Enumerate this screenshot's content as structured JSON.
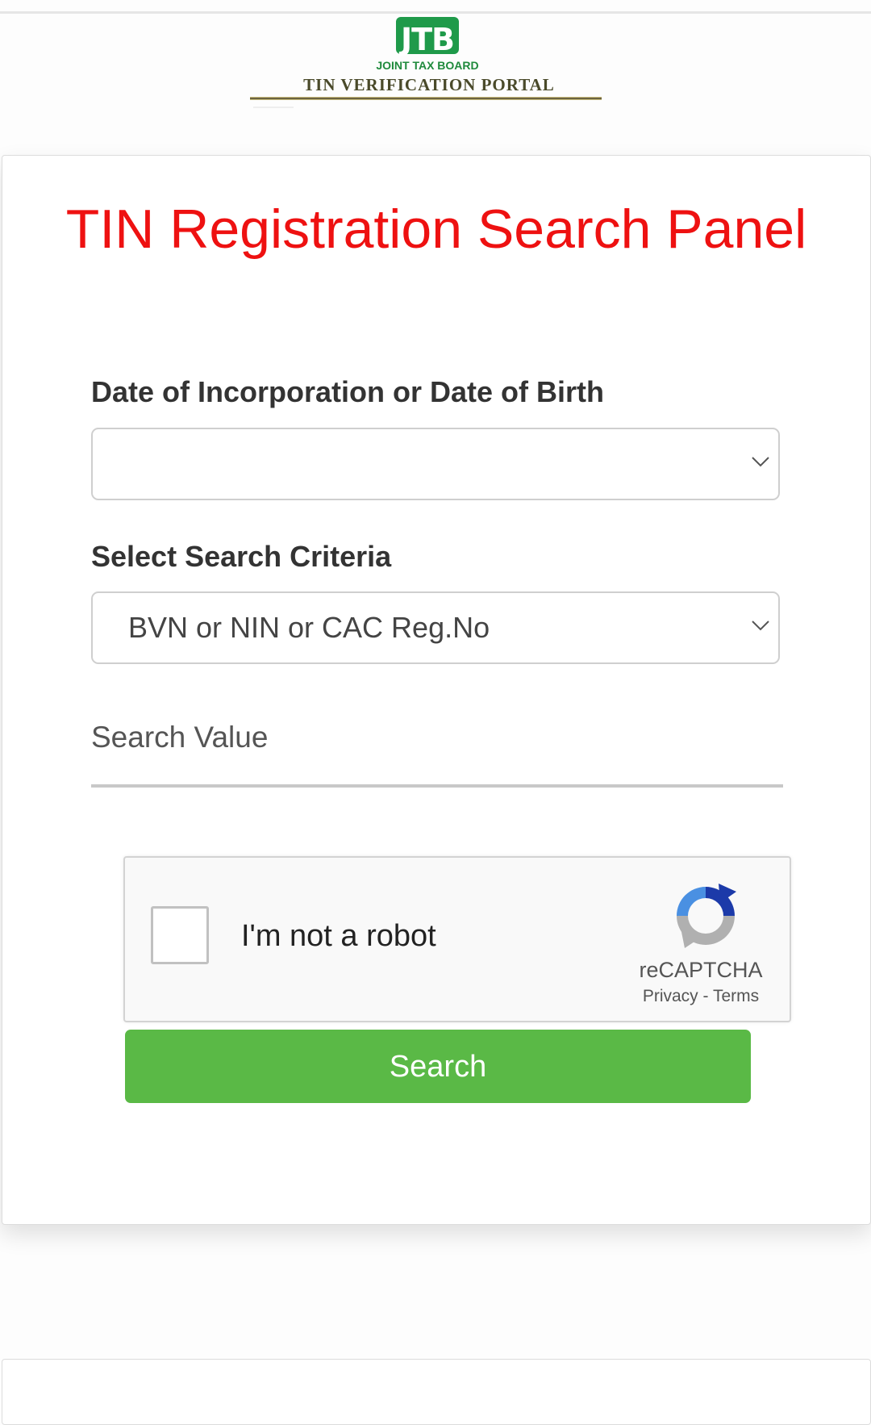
{
  "header": {
    "logo_badge_text": "JTB",
    "logo_subtitle": "JOINT TAX BOARD",
    "portal_name": "TIN VERIFICATION PORTAL"
  },
  "panel": {
    "title": "TIN Registration Search Panel",
    "date_field": {
      "label": "Date of Incorporation or Date of Birth",
      "value": ""
    },
    "criteria_field": {
      "label": "Select Search Criteria",
      "value": "BVN or NIN or CAC Reg.No"
    },
    "search_value_field": {
      "placeholder": "Search Value",
      "value": ""
    },
    "captcha": {
      "label": "I'm not a robot",
      "brand": "reCAPTCHA",
      "privacy": "Privacy",
      "separator": "-",
      "terms": "Terms"
    },
    "search_button": "Search"
  },
  "colors": {
    "title_red": "#ee1111",
    "button_green": "#5ab946",
    "logo_green": "#1f9a4a"
  },
  "icons": {
    "select_arrow": "chevron-down-icon",
    "captcha_logo": "recaptcha-icon"
  }
}
